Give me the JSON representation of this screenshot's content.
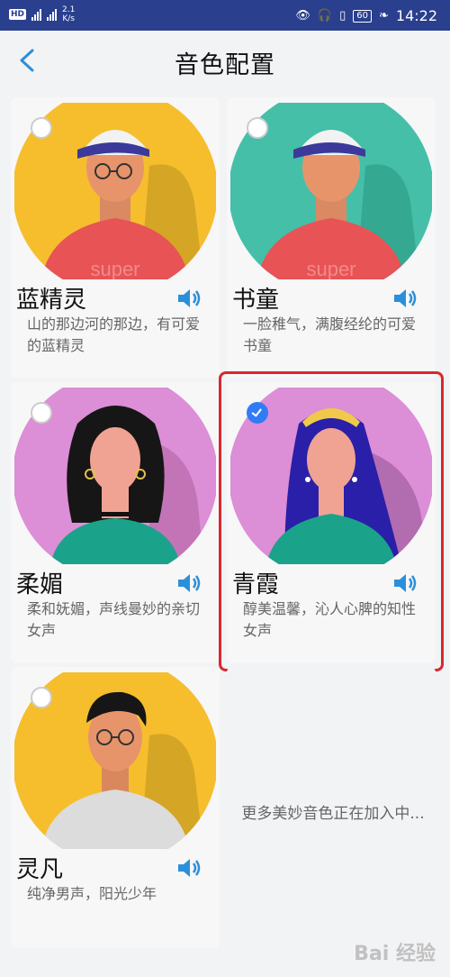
{
  "status": {
    "speed_top": "2.1",
    "speed_unit": "K/s",
    "battery": "60",
    "time": "14:22"
  },
  "header": {
    "title": "音色配置"
  },
  "voices": [
    {
      "name": "蓝精灵",
      "desc": "山的那边河的那边，有可爱的蓝精灵",
      "shirt_text": "super",
      "bg": "#f6be2d",
      "selected": false
    },
    {
      "name": "书童",
      "desc": "一脸稚气，满腹经纶的可爱书童",
      "shirt_text": "super",
      "bg": "#45bfa8",
      "selected": false
    },
    {
      "name": "柔媚",
      "desc": "柔和妩媚，声线曼妙的亲切女声",
      "bg": "#dc8ed6",
      "selected": false
    },
    {
      "name": "青霞",
      "desc": "醇美温馨，沁人心脾的知性女声",
      "bg": "#dc8ed6",
      "selected": true
    },
    {
      "name": "灵凡",
      "desc": "纯净男声，阳光少年",
      "bg": "#f6be2d",
      "selected": false
    }
  ],
  "more_text": "更多美妙音色正在加入中...",
  "watermark": "Bai 经验"
}
